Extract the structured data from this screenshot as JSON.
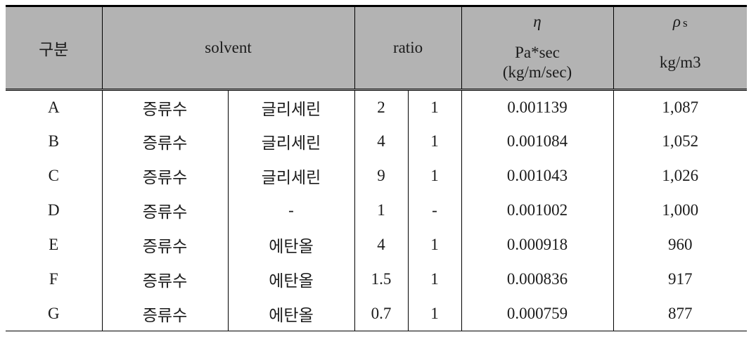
{
  "table": {
    "headers": {
      "gubun": "구분",
      "solvent": "solvent",
      "ratio": "ratio",
      "eta_symbol": "η",
      "eta_unit_line1": "Pa*sec",
      "eta_unit_line2": "(kg/m/sec)",
      "rho_symbol": "ρ",
      "rho_subscript": "s",
      "rho_unit": "kg/m3"
    },
    "rows": [
      {
        "gubun": "A",
        "solvent1": "증류수",
        "solvent2": "글리세린",
        "ratio1": "2",
        "ratio2": "1",
        "eta": "0.001139",
        "rho": "1,087"
      },
      {
        "gubun": "B",
        "solvent1": "증류수",
        "solvent2": "글리세린",
        "ratio1": "4",
        "ratio2": "1",
        "eta": "0.001084",
        "rho": "1,052"
      },
      {
        "gubun": "C",
        "solvent1": "증류수",
        "solvent2": "글리세린",
        "ratio1": "9",
        "ratio2": "1",
        "eta": "0.001043",
        "rho": "1,026"
      },
      {
        "gubun": "D",
        "solvent1": "증류수",
        "solvent2": "-",
        "ratio1": "1",
        "ratio2": "-",
        "eta": "0.001002",
        "rho": "1,000"
      },
      {
        "gubun": "E",
        "solvent1": "증류수",
        "solvent2": "에탄올",
        "ratio1": "4",
        "ratio2": "1",
        "eta": "0.000918",
        "rho": "960"
      },
      {
        "gubun": "F",
        "solvent1": "증류수",
        "solvent2": "에탄올",
        "ratio1": "1.5",
        "ratio2": "1",
        "eta": "0.000836",
        "rho": "917"
      },
      {
        "gubun": "G",
        "solvent1": "증류수",
        "solvent2": "에탄올",
        "ratio1": "0.7",
        "ratio2": "1",
        "eta": "0.000759",
        "rho": "877"
      }
    ]
  },
  "colors": {
    "header_background": "#b3b3b3",
    "border": "#000000",
    "text": "#1b1b1b",
    "page_background": "#ffffff"
  }
}
